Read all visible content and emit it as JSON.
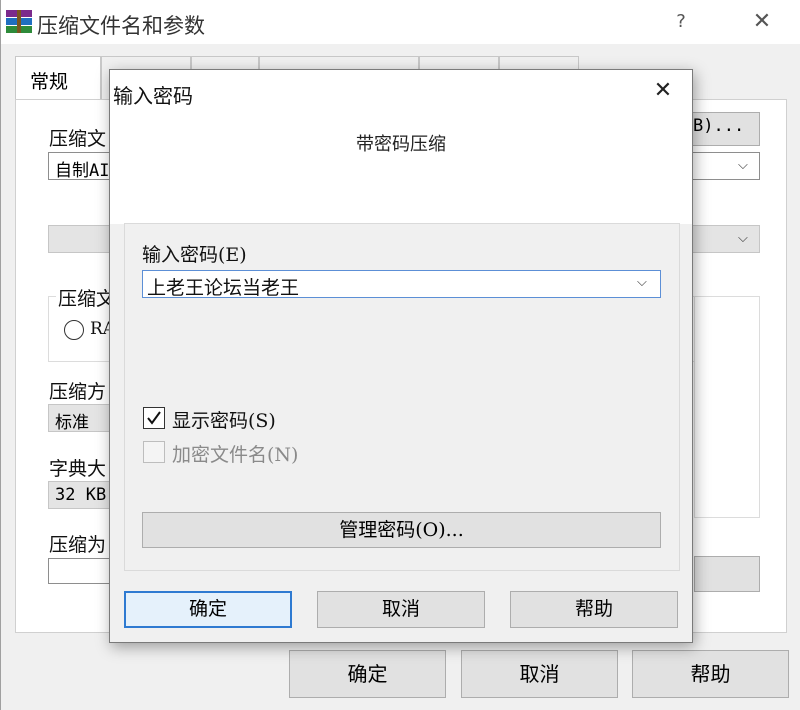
{
  "main_window": {
    "title": "压缩文件名和参数",
    "help_glyph": "?",
    "close_glyph": "✕",
    "tabs": [
      {
        "label": "常规",
        "active": true
      },
      {
        "label": "",
        "active": false
      },
      {
        "label": "",
        "active": false
      },
      {
        "label": "",
        "active": false
      },
      {
        "label": "",
        "active": false
      },
      {
        "label": "",
        "active": false
      }
    ],
    "fields": {
      "archive_name_label": "压缩文",
      "archive_name_value": "自制AI",
      "browse_button": "B)...",
      "format_label": "压缩文",
      "format_radio_rar": "RA",
      "method_label": "压缩方",
      "method_value": "标准",
      "dict_label": "字典大",
      "dict_value": "32 KB",
      "split_label": "压缩为"
    },
    "buttons": {
      "ok": "确定",
      "cancel": "取消",
      "help": "帮助"
    }
  },
  "password_dialog": {
    "title": "输入密码",
    "close_glyph": "✕",
    "subtitle": "带密码压缩",
    "password_label": "输入密码(E)",
    "password_value": "上老王论坛当老王",
    "show_password": {
      "label": "显示密码(S)",
      "checked": true,
      "enabled": true
    },
    "encrypt_filenames": {
      "label": "加密文件名(N)",
      "checked": false,
      "enabled": false
    },
    "manage_button": "管理密码(O)...",
    "buttons": {
      "ok": "确定",
      "cancel": "取消",
      "help": "帮助"
    }
  },
  "icons": {
    "app_icon": "winrar-books-icon",
    "dropdown": "chevron-down-icon",
    "check": "checkmark-icon"
  },
  "colors": {
    "focus_border": "#2e7ad1",
    "window_bg": "#f0f0f0",
    "button_bg": "#e1e1e1"
  }
}
